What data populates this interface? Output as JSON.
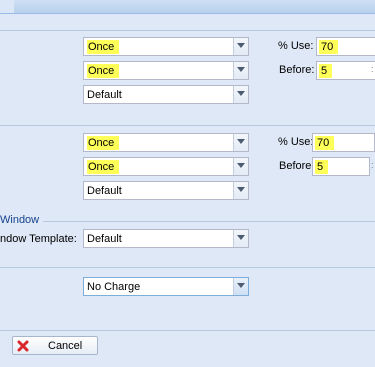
{
  "section1": {
    "combo1": "Once",
    "combo2": "Once",
    "combo3": "Default",
    "pct_label": "% Use:",
    "pct_value": "70",
    "before_label": "Before:",
    "before_value": "5"
  },
  "section2": {
    "combo1": "Once",
    "combo2": "Once",
    "combo3": "Default",
    "pct_label": "% Use:",
    "pct_value": "70",
    "before_label": "Before:",
    "before_value": "5"
  },
  "window_section": {
    "legend": "Window",
    "template_label": "ndow Template:",
    "template_value": "Default"
  },
  "charge": {
    "value": "No Charge"
  },
  "footer": {
    "cancel_label": "Cancel"
  },
  "colors": {
    "highlight": "#ffff5a",
    "panel_bg": "#dfe8f6",
    "border": "#b5b8c8",
    "cancel_icon": "#d9262a"
  },
  "icons": {
    "dropdown": "chevron-down-icon",
    "cancel": "cross-icon"
  }
}
